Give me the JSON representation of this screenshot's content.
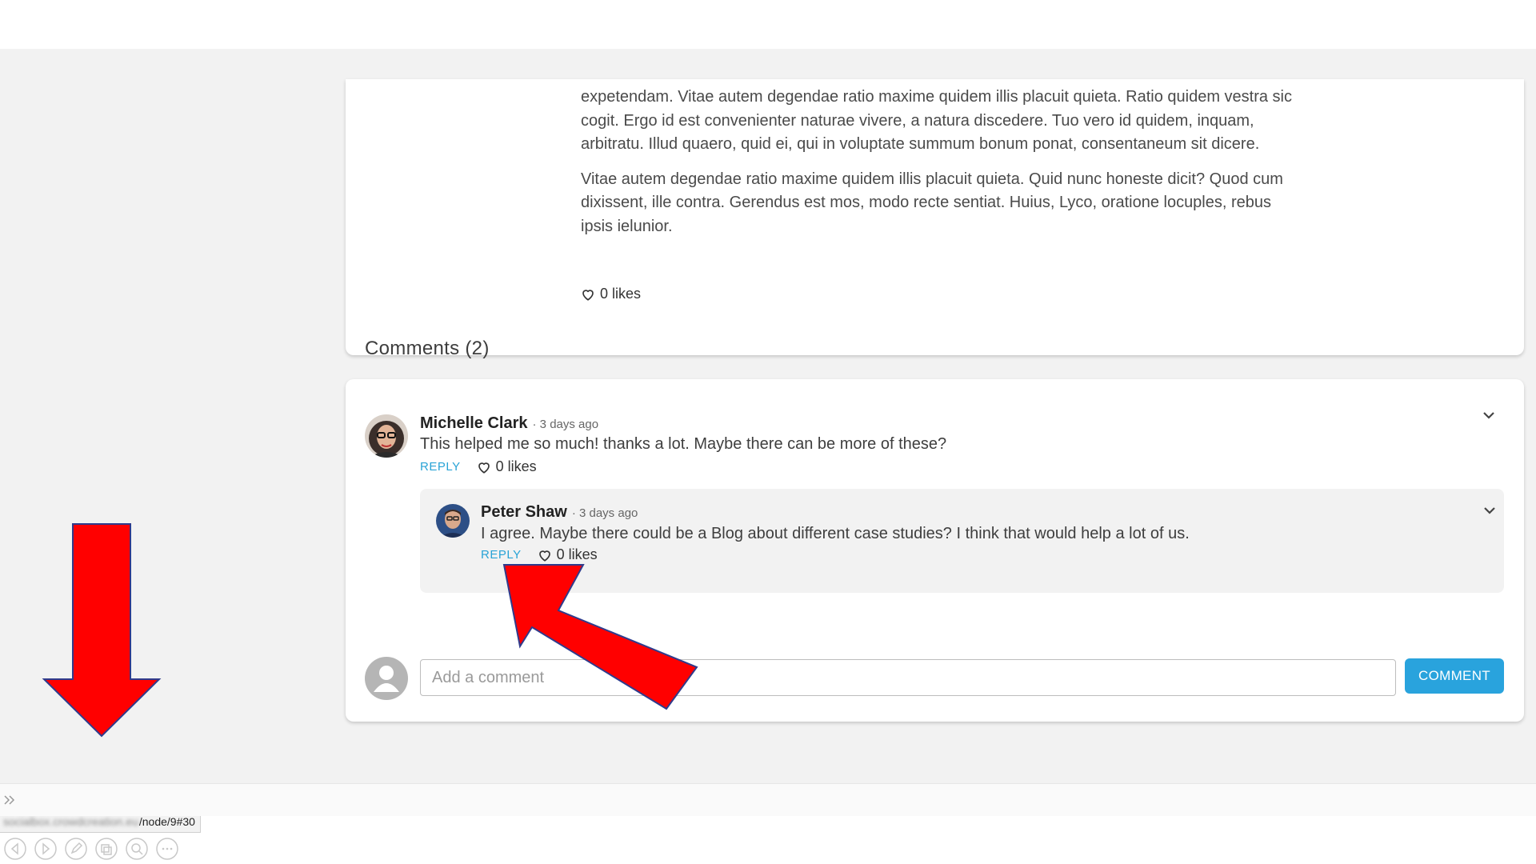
{
  "post": {
    "partial_line": "…",
    "paragraphs": [
      "expetendam. Vitae autem degendae ratio maxime quidem illis placuit quieta. Ratio quidem vestra sic cogit. Ergo id est convenienter naturae vivere, a natura discedere. Tuo vero id quidem, inquam, arbitratu. Illud quaero, quid ei, qui in voluptate summum bonum ponat, consentaneum sit dicere.",
      "Vitae autem degendae ratio maxime quidem illis placuit quieta. Quid nunc honeste dicit? Quod cum dixissent, ille contra. Gerendus est mos, modo recte sentiat. Huius, Lyco, oratione locuples, rebus ipsis ielunior."
    ],
    "likes": "0 likes"
  },
  "comments": {
    "heading": "Comments (2)",
    "items": [
      {
        "author": "Michelle Clark",
        "time": "· 3 days ago",
        "text": "This helped me so much! thanks a lot. Maybe there can be more of these?",
        "reply_label": "REPLY",
        "likes": "0 likes"
      },
      {
        "author": "Peter Shaw",
        "time": "· 3 days ago",
        "text": "I agree. Maybe there could be a Blog about different case studies? I think that would help a lot of us.",
        "reply_label": "REPLY",
        "likes": "0 likes"
      }
    ],
    "input_placeholder": "Add a comment",
    "submit_label": "COMMENT"
  },
  "status_bar": {
    "url_host": "socialbox.crowdcreation.eu",
    "url_path": "/node/9#30"
  },
  "colors": {
    "accent": "#29a3dd",
    "annotation_arrow": "#ff0000"
  },
  "icons": {
    "like": "heart-icon",
    "collapse": "chevron-down-icon",
    "default_avatar": "user-placeholder-icon",
    "expand": "double-chevron-right-icon",
    "viewer": [
      "previous-icon",
      "next-icon",
      "pen-icon",
      "slides-icon",
      "zoom-icon",
      "more-icon"
    ]
  }
}
